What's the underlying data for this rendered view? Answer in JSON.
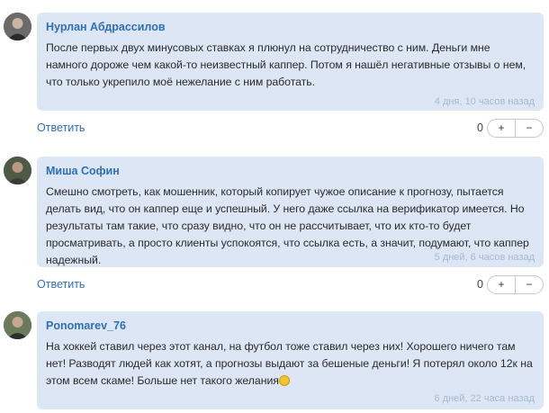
{
  "comments": [
    {
      "author": "Нурлан Абдрассилов",
      "text": "После первых двух минусовых ставках я плюнул на сотрудничество с ним. Деньги мне намного дороже чем какой-то неизвестный каппер. Потом я нашёл негативные отзывы о нем, что только укрепило моё нежелание с ним работать.",
      "time": "4 дня, 10 часов назад",
      "reply_label": "Ответить",
      "score": "0",
      "plus": "+",
      "minus": "−"
    },
    {
      "author": "Миша Софин",
      "text": "Смешно смотреть, как мошенник, который копирует чужое описание к прогнозу, пытается делать вид, что он каппер еще и успешный. У него даже ссылка на верификатор имеется. Но результаты там такие, что сразу видно, что он не рассчитывает, что их кто-то будет просматривать, а просто клиенты успокоятся, что ссылка есть, а значит, подумают, что каппер надежный.",
      "time": "5 дней, 6 часов назад",
      "reply_label": "Ответить",
      "score": "0",
      "plus": "+",
      "minus": "−"
    },
    {
      "author": "Ponomarev_76",
      "text": "На хоккей ставил через этот канал, на футбол тоже ставил через них! Хорошего ничего там нет! Разводят людей как хотят, а прогнозы выдают за бешеные деньги! Я потерял около 12к на этом всем скаме! Больше нет такого желания",
      "time": "6 дней, 22 часа назад"
    }
  ]
}
